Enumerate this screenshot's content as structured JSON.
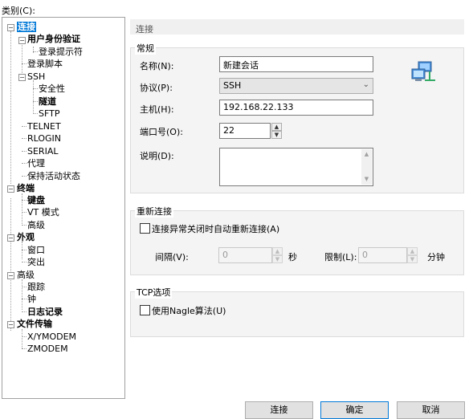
{
  "category_label": "类别(C):",
  "tree": {
    "nodes": [
      {
        "label": "连接"
      },
      {
        "label": "用户身份验证"
      },
      {
        "label": "登录提示符"
      },
      {
        "label": "登录脚本"
      },
      {
        "label": "SSH"
      },
      {
        "label": "安全性"
      },
      {
        "label": "隧道"
      },
      {
        "label": "SFTP"
      },
      {
        "label": "TELNET"
      },
      {
        "label": "RLOGIN"
      },
      {
        "label": "SERIAL"
      },
      {
        "label": "代理"
      },
      {
        "label": "保持活动状态"
      },
      {
        "label": "终端"
      },
      {
        "label": "键盘"
      },
      {
        "label": "VT 模式"
      },
      {
        "label": "高级"
      },
      {
        "label": "外观"
      },
      {
        "label": "窗口"
      },
      {
        "label": "突出"
      },
      {
        "label": "高级"
      },
      {
        "label": "跟踪"
      },
      {
        "label": "钟"
      },
      {
        "label": "日志记录"
      },
      {
        "label": "文件传输"
      },
      {
        "label": "X/YMODEM"
      },
      {
        "label": "ZMODEM"
      }
    ],
    "selected": "连接"
  },
  "panel": {
    "title": "连接",
    "general": {
      "title": "常规",
      "name_label": "名称(N):",
      "name_value": "新建会话",
      "protocol_label": "协议(P):",
      "protocol_value": "SSH",
      "host_label": "主机(H):",
      "host_value": "192.168.22.133",
      "port_label": "端口号(O):",
      "port_value": "22",
      "desc_label": "说明(D):",
      "desc_value": ""
    },
    "reconnect": {
      "title": "重新连接",
      "checkbox_label": "连接异常关闭时自动重新连接(A)",
      "checked": false,
      "interval_label": "间隔(V):",
      "interval_value": "0",
      "interval_unit": "秒",
      "limit_label": "限制(L):",
      "limit_value": "0",
      "limit_unit": "分钟"
    },
    "tcp": {
      "title": "TCP选项",
      "checkbox_label": "使用Nagle算法(U)",
      "checked": false
    }
  },
  "buttons": {
    "connect": "连接",
    "ok": "确定",
    "cancel": "取消"
  },
  "icons": [
    "network-computers-icon"
  ]
}
